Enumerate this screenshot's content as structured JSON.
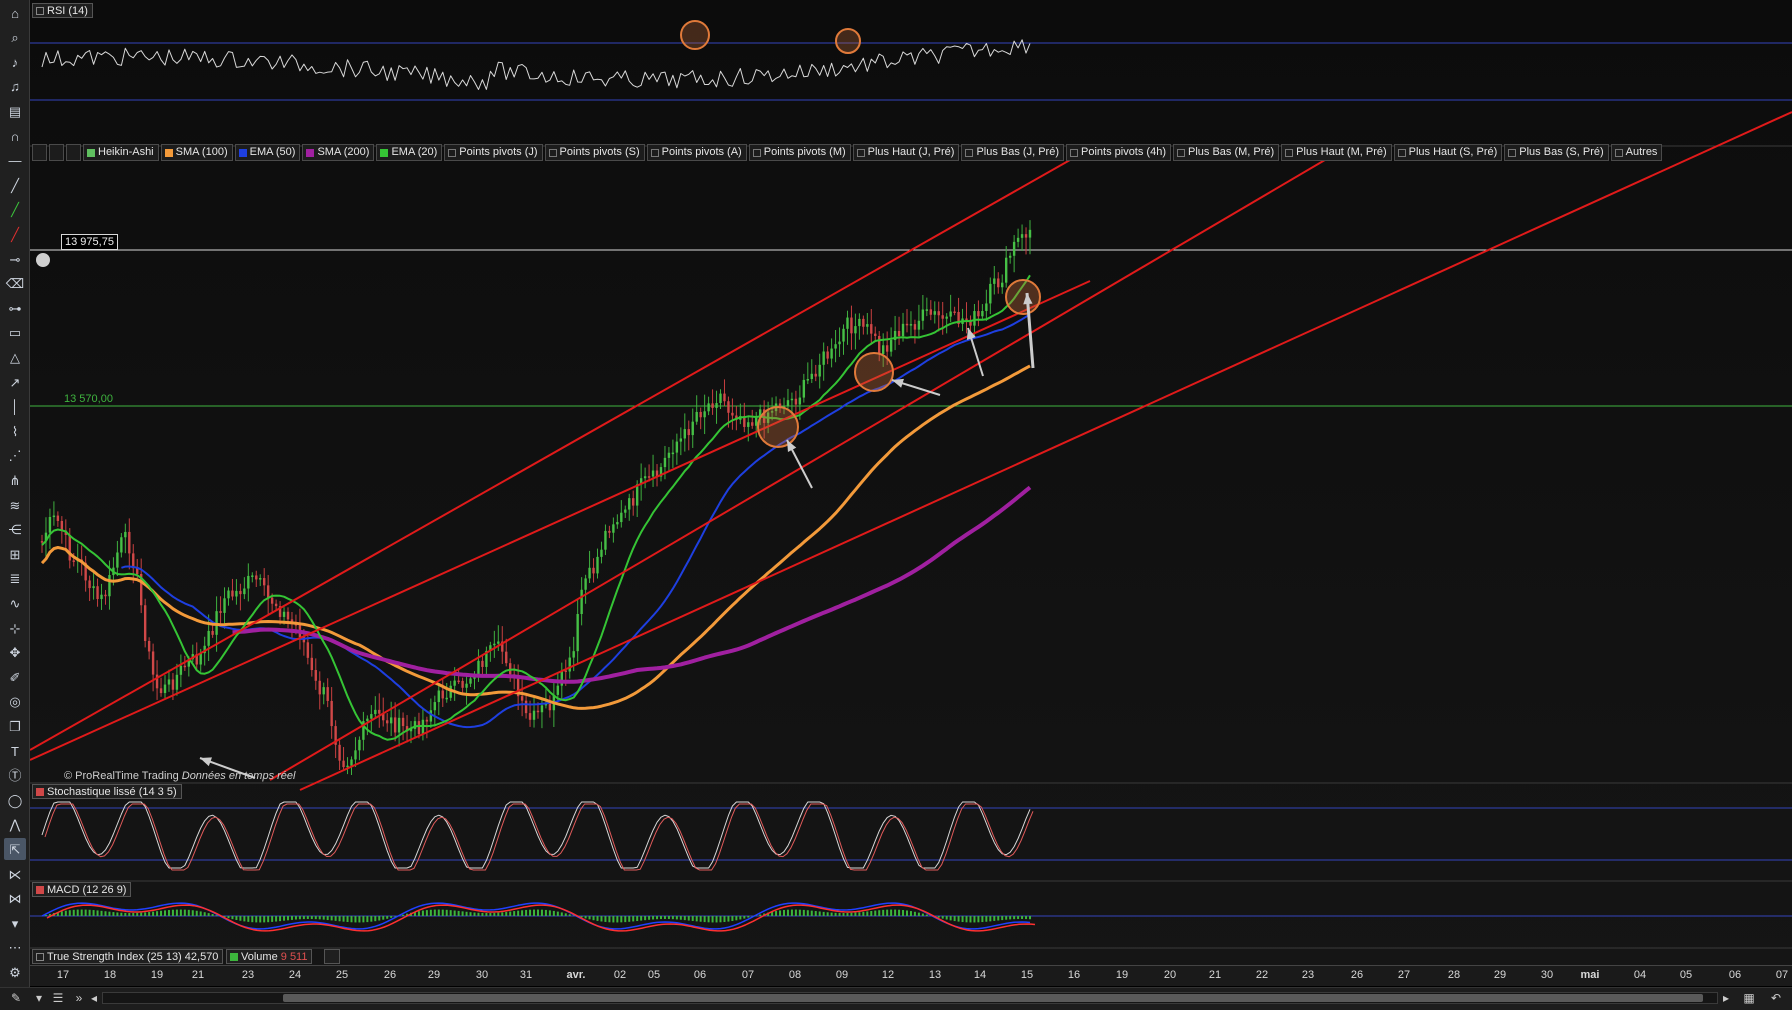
{
  "toolbar": {
    "tools": [
      "app-menu-icon",
      "zoom-icon",
      "alert-bell-icon",
      "alert-bell-add-icon",
      "ruler-icon",
      "magnet-icon",
      "horizontal-line-icon",
      "trend-line-icon",
      "green-line-icon",
      "red-line-icon",
      "horizontal-segment-icon",
      "trash-icon",
      "segment-icon",
      "rectangle-icon",
      "triangle-icon",
      "arrow-icon",
      "vertical-line-icon",
      "polyline-icon",
      "channel-icon",
      "pitchfork-icon",
      "fibonacci-icon",
      "fibonacci-fan-icon",
      "gann-icon",
      "fibonacci-retracement-icon",
      "wave-icon",
      "crosshair-tools-icon",
      "move-icon",
      "brush-icon",
      "fibonacci-arc-icon",
      "copy-icon",
      "text-icon",
      "text-cursor-icon",
      "ellipse-icon",
      "elliott-icon",
      "cursor-icon",
      "wedge-icon",
      "zigzag-icon",
      "collapse-icon",
      "more-icon",
      "settings-icon"
    ],
    "selected_index": 34
  },
  "indicators": {
    "rsi": "RSI (14)",
    "stochastic": "Stochastique lissé (14 3 5)",
    "macd": "MACD (12 26 9)",
    "tsi": "True Strength Index (25 13) 42,570",
    "volume": "Volume",
    "volume_value": "9 511"
  },
  "legend": [
    "Heikin-Ashi",
    "SMA (100)",
    "EMA (50)",
    "SMA (200)",
    "EMA (20)",
    "Points pivots (J)",
    "Points pivots (S)",
    "Points pivots (A)",
    "Points pivots (M)",
    "Plus Haut (J, Pré)",
    "Plus Bas (J, Pré)",
    "Points pivots (4h)",
    "Plus Bas (M, Pré)",
    "Plus Haut (M, Pré)",
    "Plus Haut (S, Pré)",
    "Plus Bas (S, Pré)",
    "Autres"
  ],
  "legend_colors": [
    "#5fbf5f",
    "#f39a3a",
    "#1e3fe0",
    "#a020a0",
    "#35c435",
    "",
    "",
    "",
    "",
    "",
    "",
    "",
    "",
    "",
    "",
    "",
    ""
  ],
  "levels": {
    "resistance": "13 975,75",
    "support": "13 570,00"
  },
  "copyright": "© ProRealTime Trading",
  "copyright_note": "Données en temps réel",
  "x_axis_labels": [
    "17",
    "18",
    "19",
    "21",
    "23",
    "24",
    "25",
    "26",
    "29",
    "30",
    "31",
    "avr.",
    "02",
    "05",
    "06",
    "07",
    "08",
    "09",
    "12",
    "13",
    "14",
    "15",
    "16",
    "19",
    "20",
    "21",
    "22",
    "23",
    "26",
    "27",
    "28",
    "29",
    "30",
    "mai",
    "04",
    "05",
    "06",
    "07"
  ],
  "x_axis_major": [
    "avr.",
    "mai"
  ],
  "chart_data": {
    "type": "candlestick",
    "subtype": "Heikin-Ashi",
    "series": [
      {
        "name": "Heikin-Ashi",
        "type": "candlestick",
        "colors": {
          "up": "#46c046",
          "down": "#d04848"
        }
      },
      {
        "name": "SMA (100)",
        "color": "#f39a3a"
      },
      {
        "name": "EMA (50)",
        "color": "#1e3fe0"
      },
      {
        "name": "SMA (200)",
        "color": "#a020a0"
      },
      {
        "name": "EMA (20)",
        "color": "#35c435"
      }
    ],
    "y_levels": [
      13975.75,
      13570.0
    ],
    "colors": {
      "channel": "#e01a1a",
      "resistance_line": "#d8d8d8",
      "support_line": "#3fb43f",
      "rsi_line": "#d8d8d8",
      "osc_band": "#3344bb",
      "highlight": "#e07a3a",
      "arrow": "#cccccc",
      "stoch_k": "#d8d8d8",
      "stoch_d": "#e05a5a",
      "macd_line": "#2040ff",
      "macd_signal": "#ff3030",
      "macd_hist": "#3cb43c"
    },
    "grid": false
  }
}
